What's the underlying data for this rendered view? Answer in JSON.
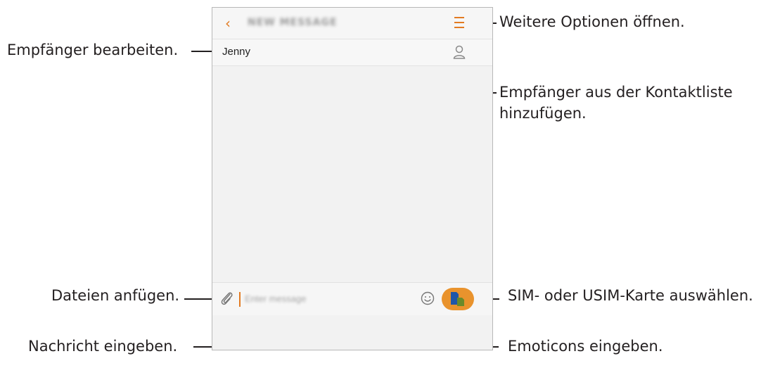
{
  "phone": {
    "title": "NEW MESSAGE",
    "recipient": "Jenny",
    "compose_placeholder": "Enter message",
    "accent_color": "#e27b22",
    "sim_button_color": "#e9932d",
    "icons": {
      "back": "chevron-left-icon",
      "menu": "menu-icon",
      "contact": "contact-icon",
      "attach": "paperclip-icon",
      "emoji": "emoji-icon",
      "sim": "sim-card-icon"
    }
  },
  "annotations": {
    "more_options": "Weitere Optionen öffnen.",
    "edit_recipient": "Empfänger bearbeiten.",
    "add_from_contacts_line1": "Empfänger aus der Kontaktliste",
    "add_from_contacts_line2": "hinzufügen.",
    "attach_files": "Dateien anfügen.",
    "select_sim": "SIM- oder USIM-Karte auswählen.",
    "enter_message": "Nachricht eingeben.",
    "enter_emoticons": "Emoticons eingeben."
  }
}
